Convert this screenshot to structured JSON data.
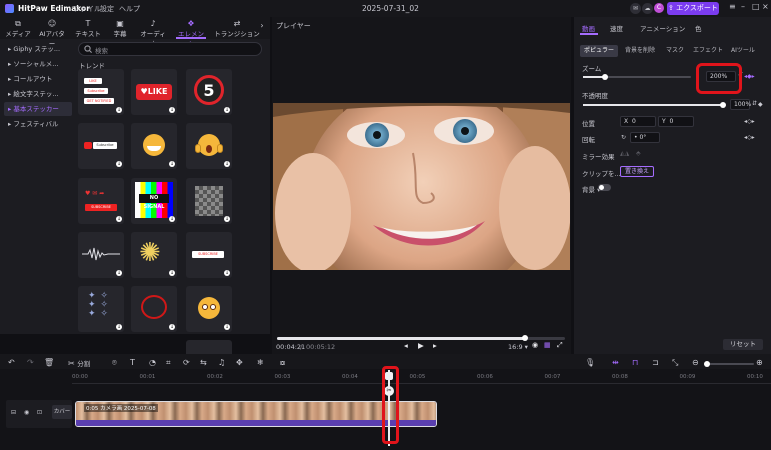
{
  "app": {
    "name": "HitPaw Edimakor",
    "menus": [
      "ファイル",
      "設定",
      "ヘルプ"
    ],
    "document_title": "2025-07-31_02",
    "export_label": "エクスポート",
    "avatar_letter": "C",
    "accent": "#7b3cf0"
  },
  "left_tabs": [
    {
      "label": "メディア",
      "icon": "media-icon"
    },
    {
      "label": "AIアバター",
      "icon": "avatar-icon"
    },
    {
      "label": "テキスト",
      "icon": "text-icon"
    },
    {
      "label": "字幕",
      "icon": "subtitle-icon"
    },
    {
      "label": "オーディオ",
      "icon": "audio-icon"
    },
    {
      "label": "エレメント",
      "icon": "element-icon",
      "active": true
    },
    {
      "label": "トランジション",
      "icon": "transition-icon"
    }
  ],
  "categories": [
    {
      "label": "Giphy ステッ..."
    },
    {
      "label": "ソーシャルメ..."
    },
    {
      "label": "コールアウト"
    },
    {
      "label": "絵文字ステッ..."
    },
    {
      "label": "基本ステッカー",
      "active": true
    },
    {
      "label": "フェスティバル"
    }
  ],
  "search": {
    "placeholder": "検索"
  },
  "section_label": "トレンド",
  "stickers": [
    {
      "name": "subscribe-stack-sticker",
      "lines": [
        "LIKE",
        "Subscribe",
        "GET NOTIFIED"
      ]
    },
    {
      "name": "like-button-sticker",
      "text": "LIKE"
    },
    {
      "name": "countdown-5-sticker",
      "text": "5"
    },
    {
      "name": "subscribe-bar-sticker",
      "text": "Subscribe"
    },
    {
      "name": "emoji-grin-sticker"
    },
    {
      "name": "emoji-scream-sticker"
    },
    {
      "name": "subscribe-icons-sticker",
      "text": "SUBSCRIBE"
    },
    {
      "name": "no-signal-sticker",
      "text": "NO SIGNAL"
    },
    {
      "name": "pixel-blur-sticker"
    },
    {
      "name": "soundwave-sticker"
    },
    {
      "name": "firework-sticker"
    },
    {
      "name": "subscribe-small-sticker",
      "text": "SUBSCRIBE"
    },
    {
      "name": "sparkles-sticker"
    },
    {
      "name": "red-circle-sticker"
    },
    {
      "name": "emoji-pleading-sticker"
    }
  ],
  "player": {
    "title": "プレイヤー",
    "current_time": "00:04:21",
    "total_time": "00:05:12",
    "aspect": "16:9",
    "progress": 0.86
  },
  "right_panel": {
    "tabs": [
      "動画",
      "速度",
      "アニメーション",
      "色"
    ],
    "subtabs": [
      "ポピュラー",
      "背景を削除",
      "マスク",
      "エフェクト",
      "AIツール"
    ],
    "zoom": {
      "label": "ズーム",
      "value": "200%",
      "level": 0.2
    },
    "opacity": {
      "label": "不透明度",
      "value": "100%",
      "level": 1.0
    },
    "position": {
      "label": "位置",
      "x_label": "X",
      "x_value": "0",
      "y_label": "Y",
      "y_value": "0"
    },
    "rotation": {
      "label": "回転",
      "value": "0°"
    },
    "mirror": {
      "label": "ミラー効果"
    },
    "clip": {
      "label": "クリップを...",
      "button": "置き換え"
    },
    "background": {
      "label": "背景"
    },
    "reset_label": "リセット"
  },
  "toolbar": {
    "split_label": "分割"
  },
  "timeline": {
    "ticks": [
      "00:00",
      "00:01",
      "00:02",
      "00:03",
      "00:04",
      "00:05",
      "00:06",
      "00:07",
      "00:08",
      "00:09",
      "00:10"
    ],
    "track_label": "カバー",
    "clip_label": "0:05 カメラ画 2025-07-08"
  },
  "highlight_color": "#e0141b"
}
